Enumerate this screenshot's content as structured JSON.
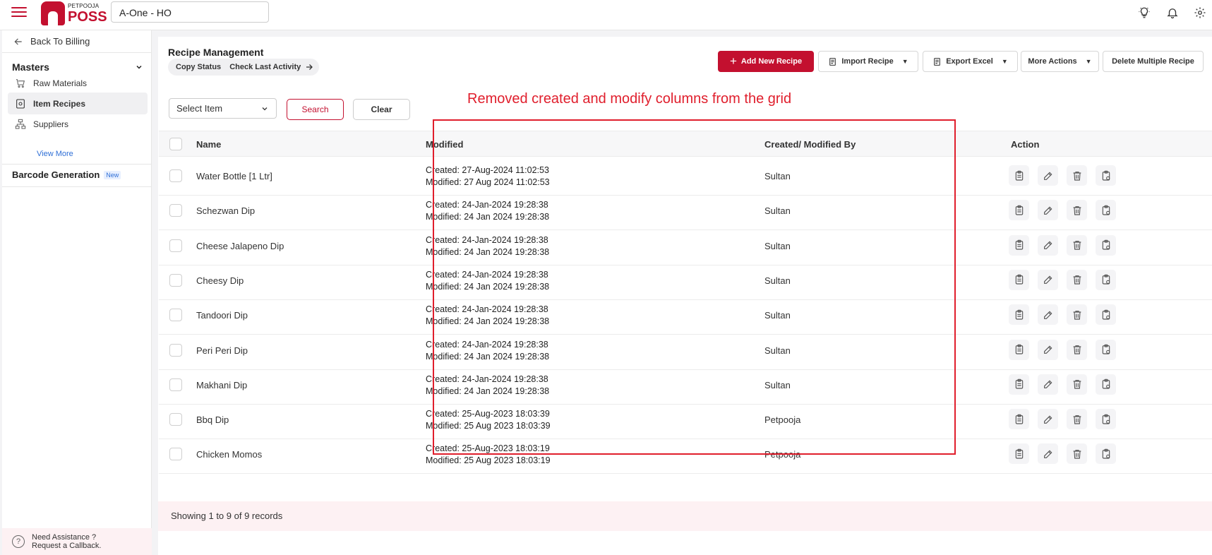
{
  "header": {
    "logo_top": "PETPOOJA",
    "logo_main": "POSS",
    "outlet": "A-One - HO",
    "icons": [
      "bulb-icon",
      "bell-icon",
      "gear-icon"
    ]
  },
  "sidebar": {
    "back": "Back To Billing",
    "section": "Masters",
    "items": [
      {
        "label": "Raw Materials",
        "icon": "cart-icon"
      },
      {
        "label": "Item Recipes",
        "icon": "recipe-icon"
      },
      {
        "label": "Suppliers",
        "icon": "suppliers-icon"
      }
    ],
    "view_more": "View More",
    "barcode": "Barcode Generation",
    "new_badge": "New",
    "help_line1": "Need Assistance ?",
    "help_line2": "Request a Callback."
  },
  "main": {
    "title": "Recipe Management",
    "copy_status": "Copy Status",
    "check_last_activity": "Check Last Activity",
    "buttons": {
      "add": "Add New Recipe",
      "import": "Import Recipe",
      "export": "Export Excel",
      "more": "More Actions",
      "delete_multiple": "Delete Multiple Recipe"
    },
    "filter": {
      "select_placeholder": "Select Item",
      "search": "Search",
      "clear": "Clear"
    },
    "annotation": "Removed created and modify columns from the grid",
    "columns": {
      "name": "Name",
      "modified": "Modified",
      "by": "Created/ Modified By",
      "action": "Action"
    },
    "rows": [
      {
        "name": "Water Bottle [1 Ltr]",
        "created": "Created: 27-Aug-2024 11:02:53",
        "modified": "Modified: 27 Aug 2024 11:02:53",
        "by": "Sultan"
      },
      {
        "name": "Schezwan Dip",
        "created": "Created: 24-Jan-2024 19:28:38",
        "modified": "Modified: 24 Jan 2024 19:28:38",
        "by": "Sultan"
      },
      {
        "name": "Cheese Jalapeno Dip",
        "created": "Created: 24-Jan-2024 19:28:38",
        "modified": "Modified: 24 Jan 2024 19:28:38",
        "by": "Sultan"
      },
      {
        "name": "Cheesy Dip",
        "created": "Created: 24-Jan-2024 19:28:38",
        "modified": "Modified: 24 Jan 2024 19:28:38",
        "by": "Sultan"
      },
      {
        "name": "Tandoori Dip",
        "created": "Created: 24-Jan-2024 19:28:38",
        "modified": "Modified: 24 Jan 2024 19:28:38",
        "by": "Sultan"
      },
      {
        "name": "Peri Peri Dip",
        "created": "Created: 24-Jan-2024 19:28:38",
        "modified": "Modified: 24 Jan 2024 19:28:38",
        "by": "Sultan"
      },
      {
        "name": "Makhani Dip",
        "created": "Created: 24-Jan-2024 19:28:38",
        "modified": "Modified: 24 Jan 2024 19:28:38",
        "by": "Sultan"
      },
      {
        "name": "Bbq Dip",
        "created": "Created: 25-Aug-2023 18:03:39",
        "modified": "Modified: 25 Aug 2023 18:03:39",
        "by": "Petpooja"
      },
      {
        "name": "Chicken Momos",
        "created": "Created: 25-Aug-2023 18:03:19",
        "modified": "Modified: 25 Aug 2023 18:03:19",
        "by": "Petpooja"
      }
    ],
    "action_icons": [
      "clipboard-icon",
      "edit-icon",
      "delete-icon",
      "copy-icon"
    ],
    "footer": "Showing 1 to 9 of 9 records"
  },
  "colors": {
    "brand": "#c3102f",
    "annotation": "#e01e2c"
  }
}
